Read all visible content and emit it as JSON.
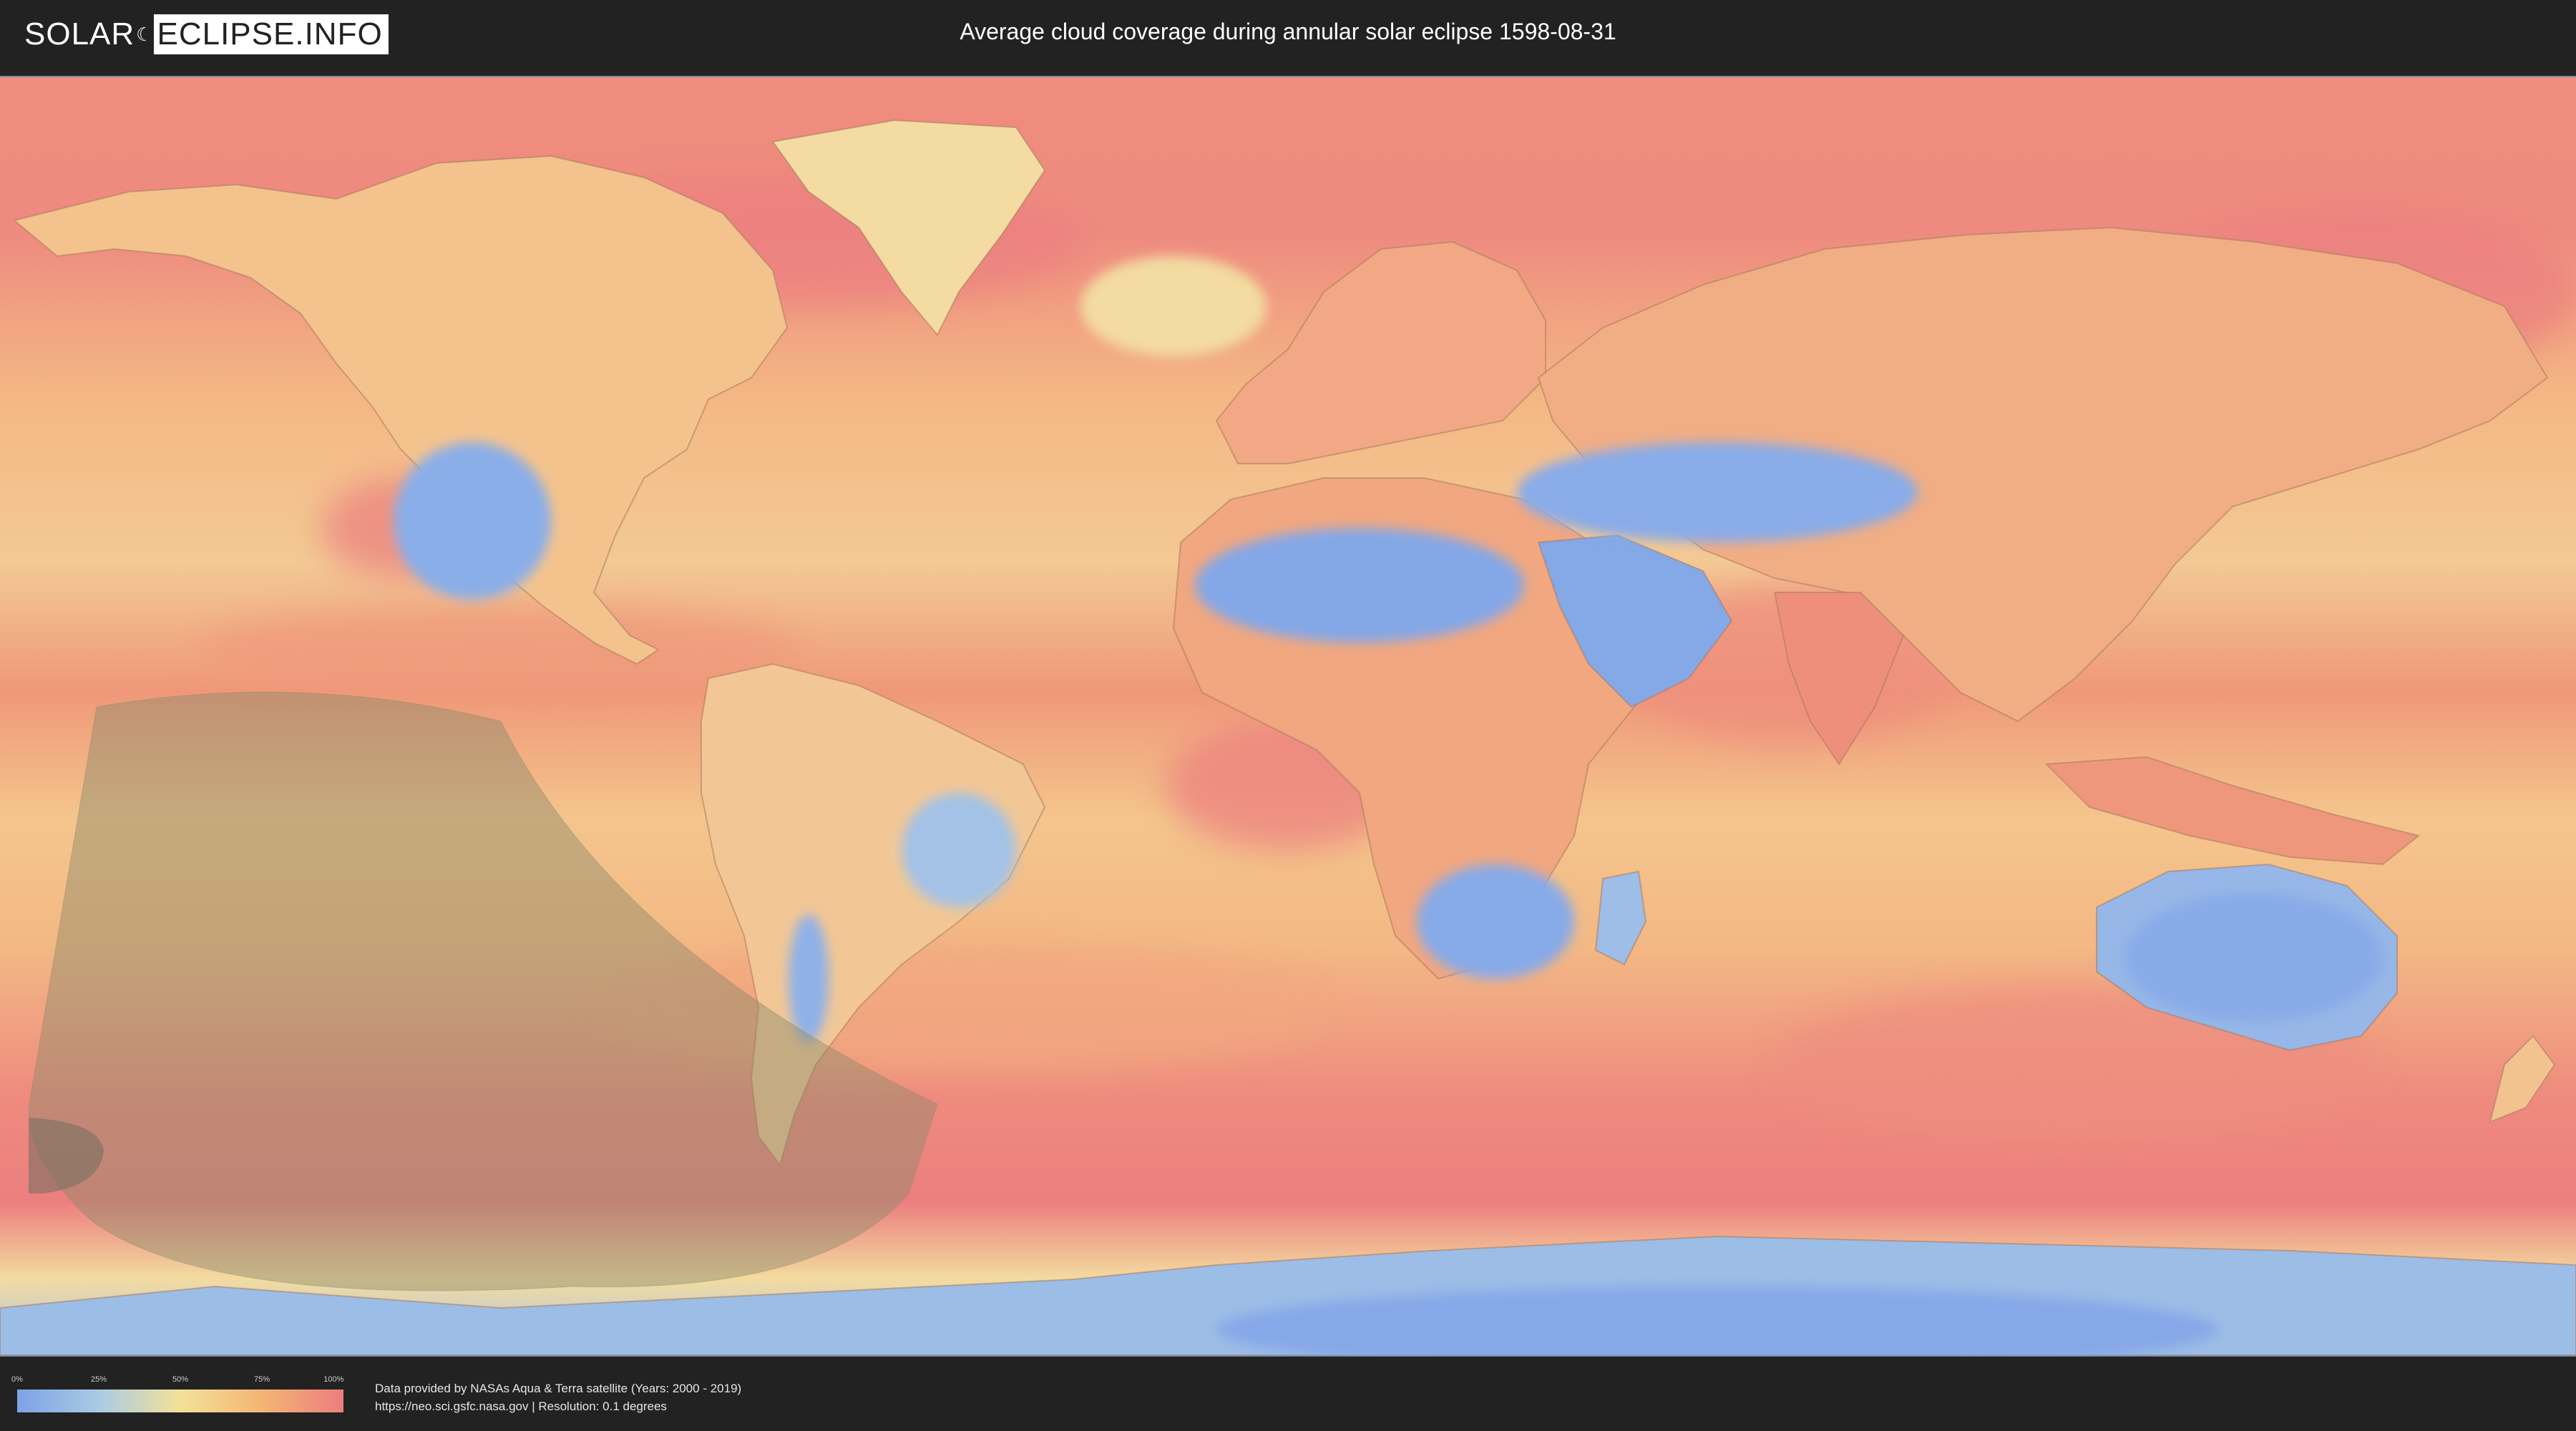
{
  "header": {
    "logo_solar": "SOLAR",
    "logo_rest": "ECLIPSE.INFO",
    "title": "Average cloud coverage during annular solar eclipse 1598-08-31"
  },
  "map": {
    "colors": {
      "ocean_high": "#ec8080",
      "ocean_mid": "#f2a37a",
      "moderate": "#f5c98f",
      "low": "#f3e3a3",
      "clear": "#82a6e8",
      "clear_light": "#a8c6e6",
      "eclipse_shadow": "#8c8a6a"
    }
  },
  "legend": {
    "ticks": [
      "0%",
      "25%",
      "50%",
      "75%",
      "100%"
    ],
    "gradient": [
      "#7ea2e6",
      "#a9cbe3",
      "#f3e19a",
      "#f4b574",
      "#ec7e7e"
    ]
  },
  "credits": {
    "line1": "Data provided by NASAs Aqua & Terra satellite (Years: 2000 - 2019)",
    "line2": "https://neo.sci.gsfc.nasa.gov | Resolution: 0.1 degrees"
  }
}
